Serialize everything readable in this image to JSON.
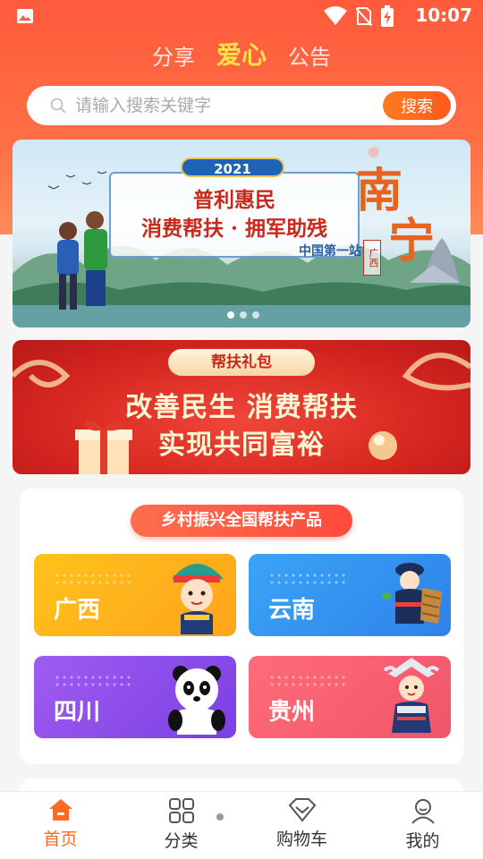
{
  "status_bar": {
    "time": "10:07"
  },
  "top_tabs": [
    {
      "label": "分享",
      "active": false
    },
    {
      "label": "爱心",
      "active": true
    },
    {
      "label": "公告",
      "active": false
    }
  ],
  "search": {
    "placeholder": "请输入搜索关键字",
    "button": "搜索"
  },
  "banner1": {
    "year": "2021",
    "line1": "普利惠民",
    "line2": "消费帮扶 · 拥军助残",
    "line3": "中国第一站",
    "city_a": "南",
    "city_b": "宁",
    "province": "广西"
  },
  "banner2": {
    "tag": "帮扶礼包",
    "line1": "改善民生  消费帮扶",
    "line2": "实现共同富裕"
  },
  "products": {
    "title": "乡村振兴全国帮扶产品",
    "tiles": [
      {
        "name": "广西",
        "icon": "guangxi-character-icon"
      },
      {
        "name": "云南",
        "icon": "yunnan-character-icon"
      },
      {
        "name": "四川",
        "icon": "panda-icon"
      },
      {
        "name": "贵州",
        "icon": "guizhou-character-icon"
      }
    ]
  },
  "bottom_nav": [
    {
      "label": "首页",
      "icon": "home-icon",
      "active": true
    },
    {
      "label": "分类",
      "icon": "grid-icon",
      "active": false
    },
    {
      "label": "购物车",
      "icon": "diamond-cart-icon",
      "active": false
    },
    {
      "label": "我的",
      "icon": "user-icon",
      "active": false
    }
  ],
  "colors": {
    "accent": "#ff6a1e",
    "header": "#ff5a3c"
  }
}
